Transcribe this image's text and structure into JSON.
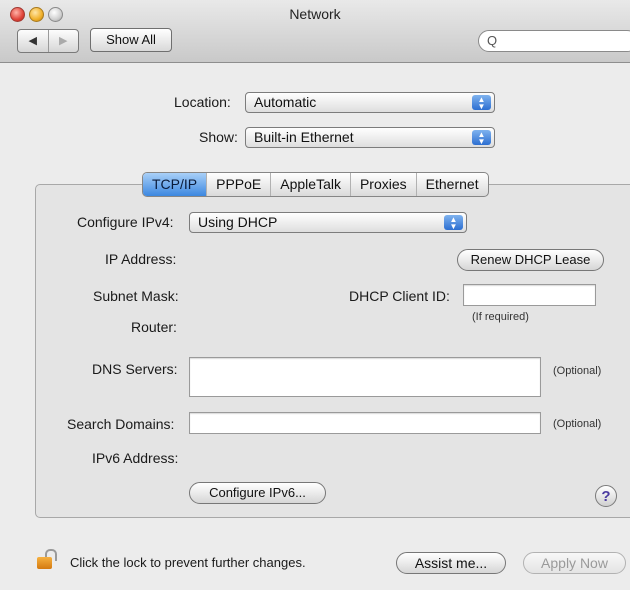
{
  "window": {
    "title": "Network"
  },
  "toolbar": {
    "back_glyph": "◀",
    "forward_glyph": "▶",
    "show_all_label": "Show All",
    "search_icon": "search-icon",
    "search_glyph": "Q"
  },
  "location": {
    "label": "Location:",
    "value": "Automatic"
  },
  "show": {
    "label": "Show:",
    "value": "Built-in Ethernet"
  },
  "tabs": [
    {
      "label": "TCP/IP",
      "active": true
    },
    {
      "label": "PPPoE",
      "active": false
    },
    {
      "label": "AppleTalk",
      "active": false
    },
    {
      "label": "Proxies",
      "active": false
    },
    {
      "label": "Ethernet",
      "active": false
    }
  ],
  "tcpip": {
    "configure_ipv4_label": "Configure IPv4:",
    "configure_ipv4_value": "Using DHCP",
    "ip_address_label": "IP Address:",
    "renew_button": "Renew DHCP Lease",
    "subnet_mask_label": "Subnet Mask:",
    "dhcp_client_id_label": "DHCP Client ID:",
    "dhcp_client_id_value": "",
    "if_required": "(If required)",
    "router_label": "Router:",
    "dns_servers_label": "DNS Servers:",
    "dns_optional": "(Optional)",
    "search_domains_label": "Search Domains:",
    "search_optional": "(Optional)",
    "ipv6_address_label": "IPv6 Address:",
    "configure_ipv6_button": "Configure IPv6...",
    "help_glyph": "?"
  },
  "footer": {
    "lock_text": "Click the lock to prevent further changes.",
    "assist_button": "Assist me...",
    "apply_button": "Apply Now"
  }
}
